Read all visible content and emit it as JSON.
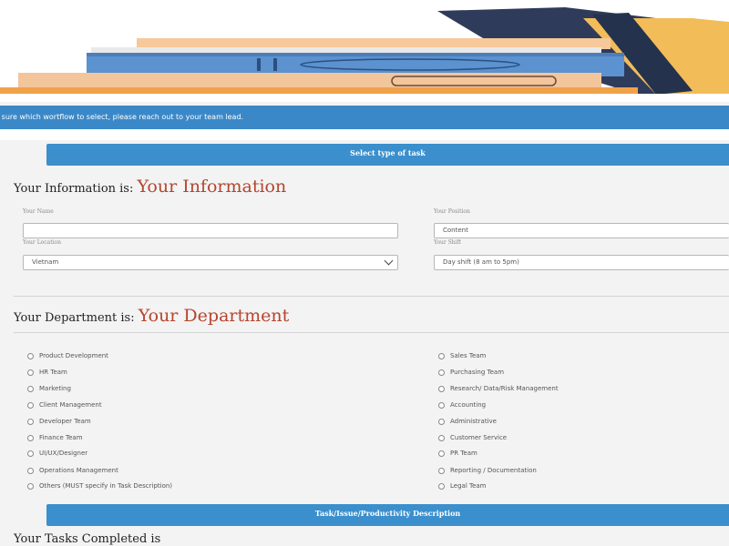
{
  "banner": {
    "text": "t sure which wortflow to select, please reach out to your team lead."
  },
  "sections": {
    "task_type": "Select type of task",
    "task_description": "Task/Issue/Productivity Description"
  },
  "info": {
    "heading_prefix": "Your Information is:",
    "heading_accent": "Your Information",
    "name_label": "Your Name",
    "name_value": "",
    "position_label": "Your Position",
    "position_value": "Content",
    "location_label": "Your Location",
    "location_value": "Vietnam",
    "shift_label": "Your Shift",
    "shift_value": "Day shift (8 am to 5pm)"
  },
  "department": {
    "heading_prefix": "Your Department is:",
    "heading_accent": "Your Department",
    "left": [
      "Product Development",
      "HR Team",
      "Marketing",
      "Client Management",
      "Developer Team",
      "Finance Team",
      "UI/UX/Designer",
      "Operations Management",
      "Others (MUST specify in Task Description)"
    ],
    "right": [
      "Sales Team",
      "Purchasing Team",
      "Research/ Data/Risk Management",
      "Accounting",
      "Administrative",
      "Customer Service",
      "PR Team",
      "Reporting / Documentation",
      "Legal Team"
    ]
  },
  "tasks": {
    "heading": "Your Tasks Completed is"
  },
  "colors": {
    "accent": "#b5452e",
    "bar": "#3a8fcc",
    "banner": "#3a88c8"
  },
  "icons": {
    "hero": "books-illustration",
    "select": "chevron-down-icon"
  }
}
